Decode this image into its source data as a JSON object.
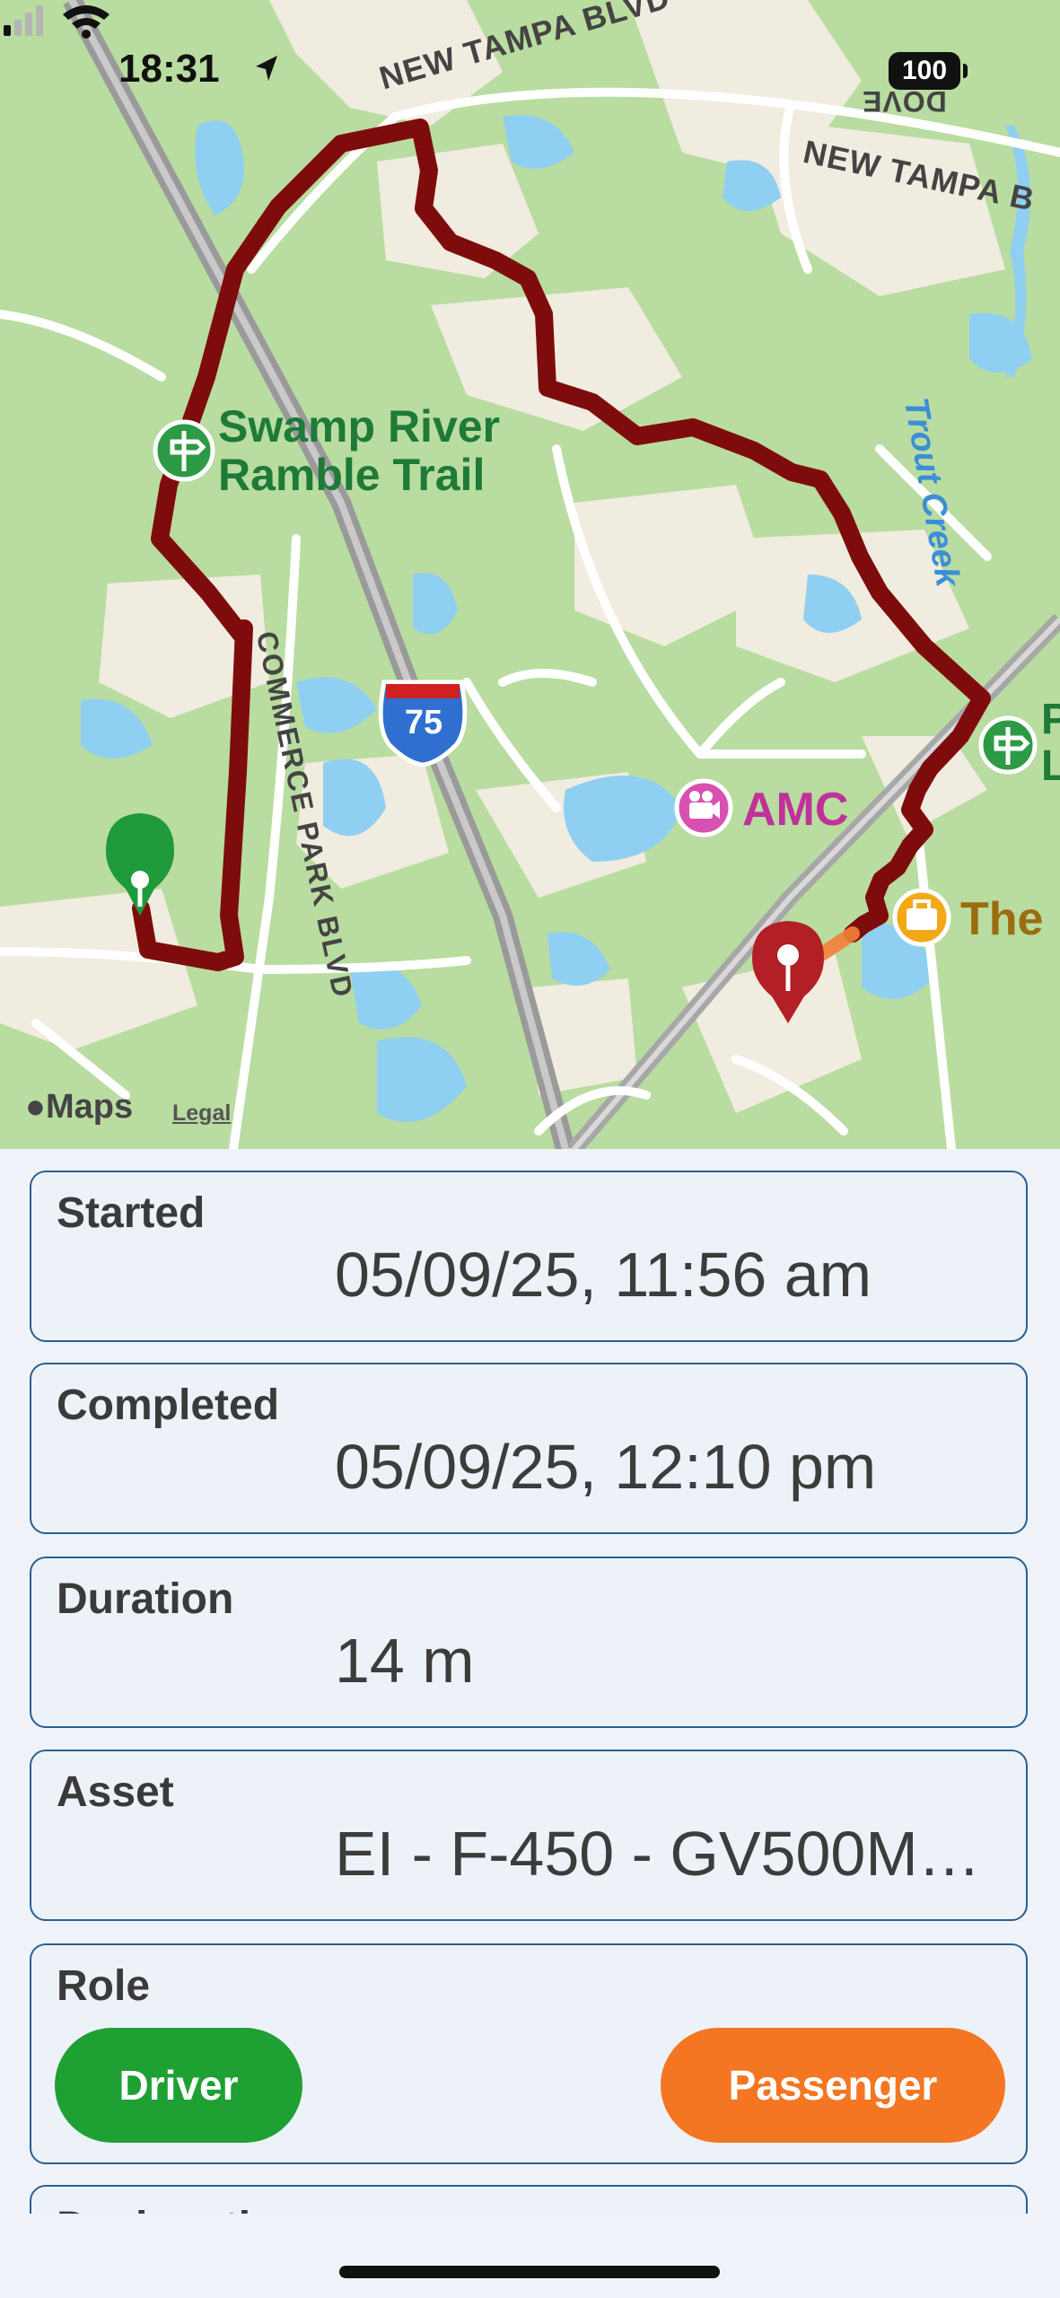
{
  "status_bar": {
    "time": "18:31",
    "battery": "100"
  },
  "map": {
    "labels": {
      "new_tampa_blvd_1": "NEW TAMPA BLVD",
      "new_tampa_blvd_2": "NEW TAMPA B",
      "dove": "DOVE",
      "trout_creek": "Trout Creek",
      "swamp_trail_line1": "Swamp River",
      "swamp_trail_line2": "Ramble Trail",
      "commerce_park": "COMMERCE PARK BLVD",
      "interstate": "75",
      "amc": "AMC",
      "the": "The",
      "right_edge_p": "P",
      "right_edge_l": "L"
    },
    "attribution": {
      "logo": "Maps",
      "legal": "Legal"
    },
    "colors": {
      "route": "#7f0c0c",
      "start_pin": "#1f9a3a",
      "end_pin": "#b21f24",
      "water": "#8fcff2",
      "road": "#ffffff",
      "highway": "#9a9a9a"
    }
  },
  "details": {
    "started": {
      "label": "Started",
      "value": "05/09/25, 11:56 am"
    },
    "completed": {
      "label": "Completed",
      "value": "05/09/25, 12:10 pm"
    },
    "duration": {
      "label": "Duration",
      "value": "14 m"
    },
    "asset": {
      "label": "Asset",
      "value": "EI - F-450 - GV500M…"
    },
    "role": {
      "label": "Role",
      "driver": {
        "label": "Driver",
        "color": "#1fa033"
      },
      "passenger": {
        "label": "Passenger",
        "color": "#f47622"
      }
    },
    "next_card_label": "Designation"
  }
}
